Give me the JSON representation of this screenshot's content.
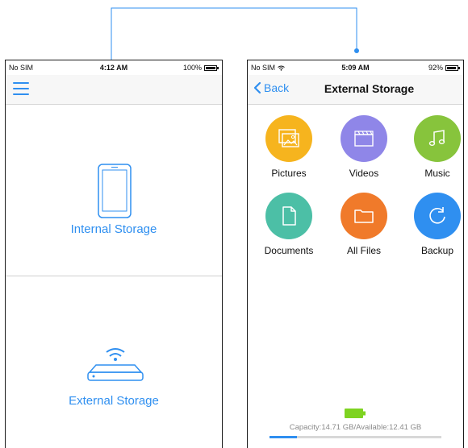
{
  "left_phone": {
    "status": {
      "carrier": "No SIM",
      "time": "4:12 AM",
      "battery": "100%",
      "battery_level": 1.0
    },
    "menu_icon": "hamburger-icon",
    "tiles": {
      "internal": {
        "label": "Internal Storage",
        "icon": "phone-icon"
      },
      "external": {
        "label": "External Storage",
        "icon": "wifi-drive-icon"
      }
    }
  },
  "right_phone": {
    "status": {
      "carrier": "No SIM",
      "time": "5:09 AM",
      "battery": "92%",
      "battery_level": 0.92
    },
    "back_label": "Back",
    "title": "External Storage",
    "categories": [
      {
        "label": "Pictures",
        "icon": "pictures-icon",
        "color": "#f6b41e"
      },
      {
        "label": "Videos",
        "icon": "clapboard-icon",
        "color": "#8f86e8"
      },
      {
        "label": "Music",
        "icon": "music-note-icon",
        "color": "#87c43c"
      },
      {
        "label": "Documents",
        "icon": "document-icon",
        "color": "#4cbfa6"
      },
      {
        "label": "All Files",
        "icon": "folder-icon",
        "color": "#f07a2a"
      },
      {
        "label": "Backup",
        "icon": "refresh-icon",
        "color": "#2f8ff0"
      }
    ],
    "capacity_text": "Capacity:14.71 GB/Available:12.41 GB",
    "used_fraction": 0.16
  },
  "colors": {
    "accent": "#2f8ff0",
    "drive_battery": "#7ed321"
  }
}
